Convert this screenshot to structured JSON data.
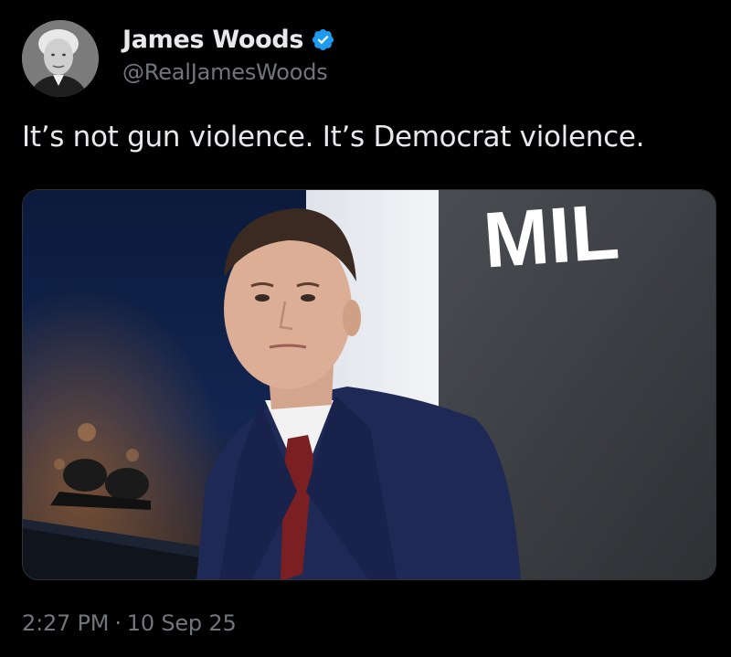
{
  "author": {
    "display_name": "James Woods",
    "handle": "@RealJamesWoods",
    "verified_icon": "verified-badge-icon",
    "verified_color": "#1d9bf0"
  },
  "tweet": {
    "text": "It’s not gun violence. It’s Democrat violence."
  },
  "media": {
    "banner_text": "MIL",
    "description_icon": "photo"
  },
  "meta": {
    "time": "2:27 PM",
    "separator": "·",
    "date": "10 Sep 25"
  }
}
